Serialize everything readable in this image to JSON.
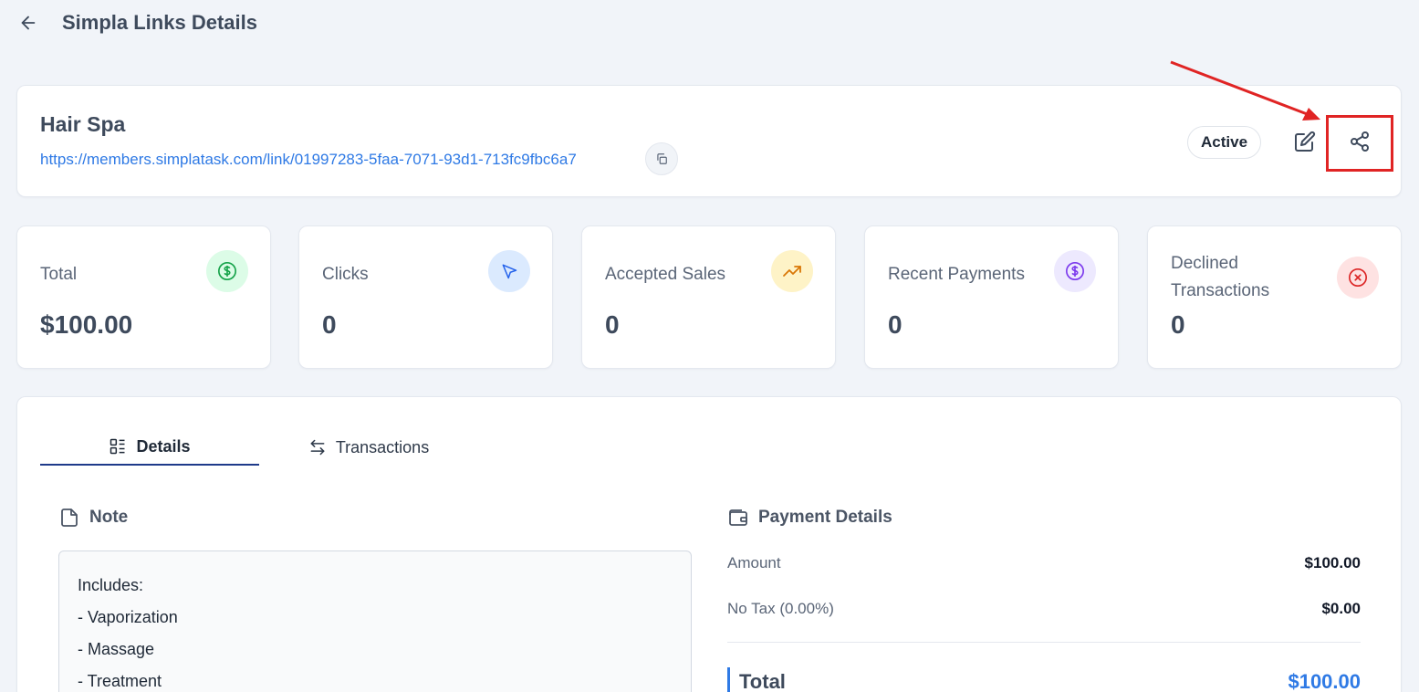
{
  "header": {
    "title": "Simpla Links Details"
  },
  "link": {
    "name": "Hair Spa",
    "url": "https://members.simplatask.com/link/01997283-5faa-7071-93d1-713fc9fbc6a7",
    "status": "Active"
  },
  "stats": [
    {
      "label": "Total",
      "value": "$100.00",
      "icon": "dollar-icon",
      "color": "#dcfce7"
    },
    {
      "label": "Clicks",
      "value": "0",
      "icon": "cursor-icon",
      "color": "#dbeafe"
    },
    {
      "label": "Accepted Sales",
      "value": "0",
      "icon": "trending-up-icon",
      "color": "#fef3c7"
    },
    {
      "label": "Recent Payments",
      "value": "0",
      "icon": "dollar-icon",
      "color": "#ede9fe"
    },
    {
      "label": "Declined Transactions",
      "value": "0",
      "icon": "x-circle-icon",
      "color": "#fee2e2"
    }
  ],
  "tabs": [
    {
      "label": "Details",
      "icon": "list-icon",
      "active": true
    },
    {
      "label": "Transactions",
      "icon": "swap-icon",
      "active": false
    }
  ],
  "note": {
    "title": "Note",
    "lines": [
      "Includes:",
      "- Vaporization",
      "- Massage",
      "- Treatment"
    ]
  },
  "payment": {
    "title": "Payment Details",
    "rows": [
      {
        "label": "Amount",
        "value": "$100.00"
      },
      {
        "label": "No Tax (0.00%)",
        "value": "$0.00"
      }
    ],
    "total_label": "Total",
    "total_value": "$100.00"
  },
  "colors": {
    "accent": "#2f7ae5",
    "highlight": "#e02424"
  }
}
